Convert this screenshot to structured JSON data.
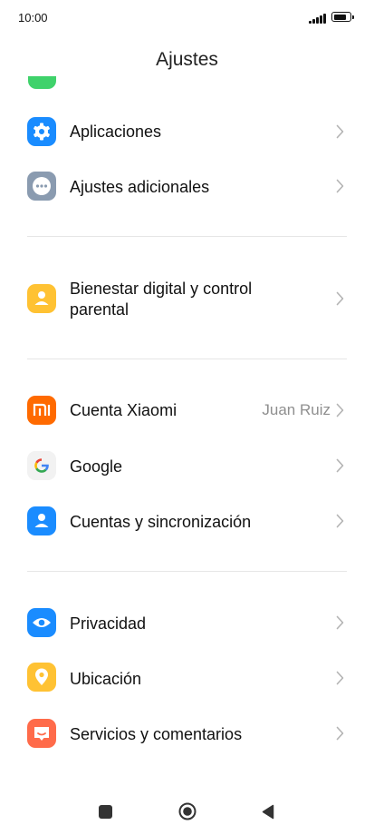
{
  "status_bar": {
    "time": "10:00",
    "battery_level": 0.85
  },
  "header": {
    "title": "Ajustes"
  },
  "items": [
    {
      "label": "Aplicaciones",
      "icon": "gear-icon",
      "color": "#1a8cff"
    },
    {
      "label": "Ajustes adicionales",
      "icon": "more-dots-icon",
      "color": "#8a9bb0"
    },
    {
      "label_line1": "Bienestar digital y control",
      "label_line2": "parental",
      "icon": "digital-wellbeing-icon",
      "color": "#ffc233"
    },
    {
      "label": "Cuenta Xiaomi",
      "value": "Juan Ruiz",
      "icon": "mi-logo-icon",
      "color": "#ff6a00"
    },
    {
      "label": "Google",
      "icon": "google-g-icon",
      "color": "#f2f2f2"
    },
    {
      "label": "Cuentas y sincronización",
      "icon": "account-person-icon",
      "color": "#1a8cff"
    },
    {
      "label": "Privacidad",
      "icon": "eye-icon",
      "color": "#1a8cff"
    },
    {
      "label": "Ubicación",
      "icon": "location-pin-icon",
      "color": "#ffc233"
    },
    {
      "label": "Servicios y comentarios",
      "icon": "feedback-chat-icon",
      "color": "#ff6b4a"
    }
  ],
  "navbar": {
    "buttons": [
      "recents-square-icon",
      "home-circle-icon",
      "back-triangle-icon"
    ]
  }
}
